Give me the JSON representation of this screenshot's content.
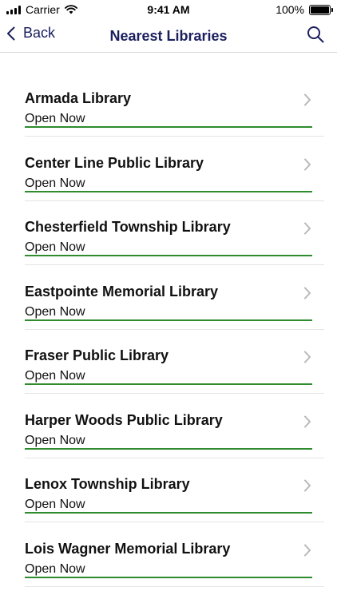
{
  "status_bar": {
    "carrier": "Carrier",
    "time": "9:41 AM",
    "battery": "100%",
    "battery_level": 1.0
  },
  "nav": {
    "back_label": "Back",
    "title": "Nearest Libraries",
    "back_icon": "chevron-left-icon",
    "search_icon": "search-icon"
  },
  "colors": {
    "accent": "#1b1f5e",
    "open_line": "#2e8b2e",
    "chevron": "#b8b8b8"
  },
  "libraries": [
    {
      "name": "Armada Library",
      "status": "Open Now"
    },
    {
      "name": "Center Line Public Library",
      "status": "Open Now"
    },
    {
      "name": "Chesterfield Township Library",
      "status": "Open Now"
    },
    {
      "name": "Eastpointe Memorial Library",
      "status": "Open Now"
    },
    {
      "name": "Fraser Public Library",
      "status": "Open Now"
    },
    {
      "name": "Harper Woods Public Library",
      "status": "Open Now"
    },
    {
      "name": "Lenox Township Library",
      "status": "Open Now"
    },
    {
      "name": "Lois Wagner Memorial Library",
      "status": "Open Now"
    }
  ]
}
